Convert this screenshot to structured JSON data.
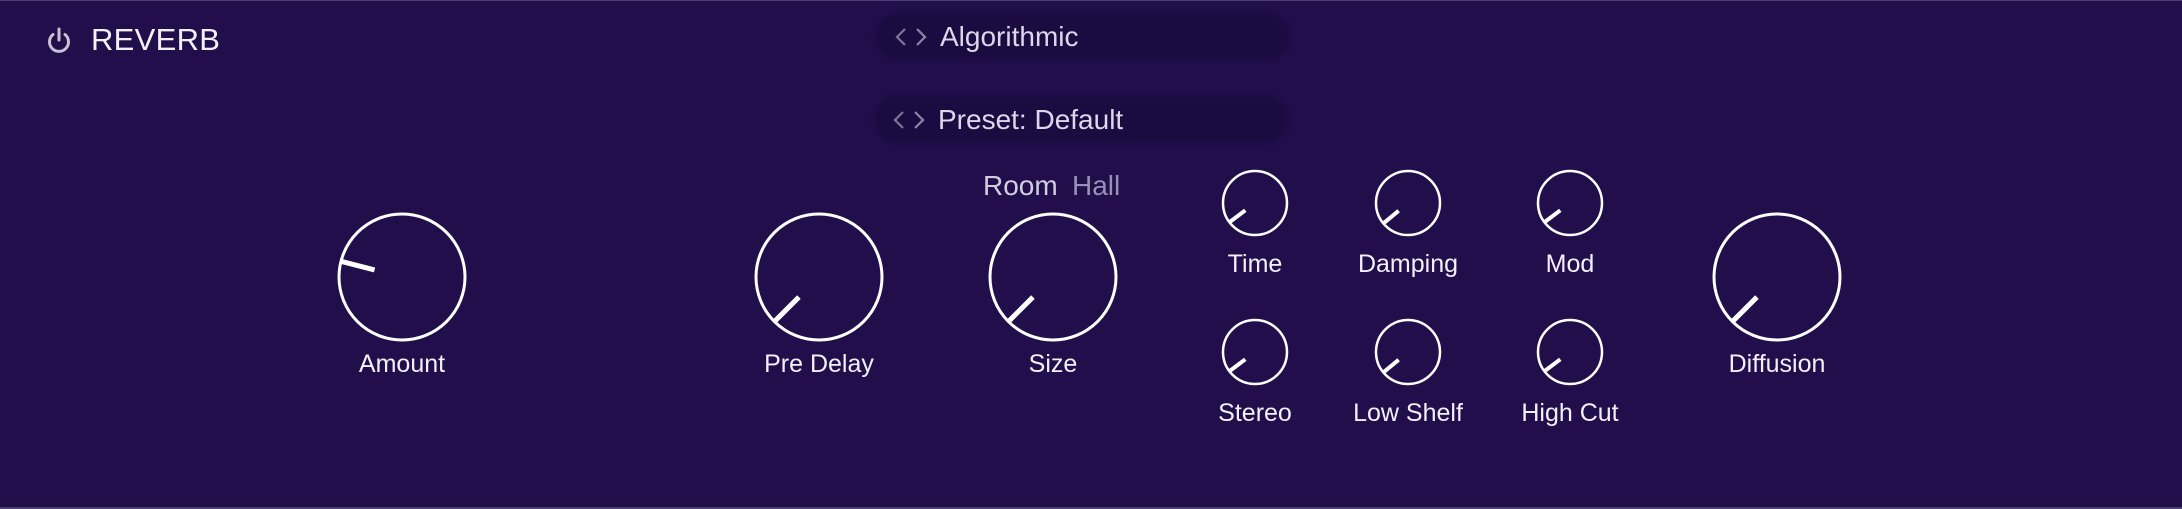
{
  "header": {
    "title": "REVERB",
    "power_icon": "power-icon",
    "power_on": true
  },
  "algorithm_selector": {
    "prev_icon": "chevron-left-icon",
    "next_icon": "chevron-right-icon",
    "value": "Algorithmic"
  },
  "preset_selector": {
    "prev_icon": "chevron-left-icon",
    "next_icon": "chevron-right-icon",
    "value": "Preset: Default"
  },
  "mode_toggle": {
    "options": [
      "Room",
      "Hall"
    ],
    "selected": "Room"
  },
  "knobs": [
    {
      "id": "amount",
      "label": "Amount",
      "value": 0.22
    },
    {
      "id": "pre-delay",
      "label": "Pre Delay",
      "value": 0.0
    },
    {
      "id": "size",
      "label": "Size",
      "value": 0.0
    },
    {
      "id": "time",
      "label": "Time",
      "value": 0.03
    },
    {
      "id": "damping",
      "label": "Damping",
      "value": 0.02
    },
    {
      "id": "mod",
      "label": "Mod",
      "value": 0.03
    },
    {
      "id": "stereo",
      "label": "Stereo",
      "value": 0.03
    },
    {
      "id": "low-shelf",
      "label": "Low Shelf",
      "value": 0.02
    },
    {
      "id": "high-cut",
      "label": "High Cut",
      "value": 0.03
    },
    {
      "id": "diffusion",
      "label": "Diffusion",
      "value": 0.0
    }
  ],
  "colors": {
    "background": "#210e4b",
    "knob_stroke": "#ffffff",
    "text": "#f3f0fa",
    "dim_text": "#9a8fb5"
  }
}
